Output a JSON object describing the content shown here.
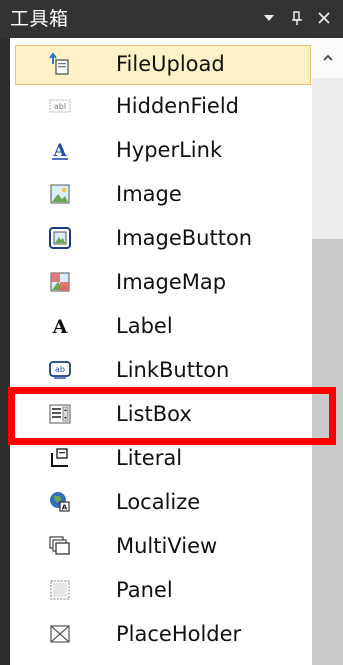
{
  "window": {
    "title": "工具箱"
  },
  "toolbar_buttons": [
    {
      "icon": "dropdown-arrow-icon"
    },
    {
      "icon": "pin-icon"
    },
    {
      "icon": "close-icon"
    }
  ],
  "items": [
    {
      "label": "FileUpload",
      "icon": "file-upload-icon",
      "selected": true
    },
    {
      "label": "HiddenField",
      "icon": "hidden-field-icon",
      "selected": false
    },
    {
      "label": "HyperLink",
      "icon": "hyperlink-icon",
      "selected": false
    },
    {
      "label": "Image",
      "icon": "image-icon",
      "selected": false
    },
    {
      "label": "ImageButton",
      "icon": "image-button-icon",
      "selected": false
    },
    {
      "label": "ImageMap",
      "icon": "image-map-icon",
      "selected": false
    },
    {
      "label": "Label",
      "icon": "label-icon",
      "selected": false
    },
    {
      "label": "LinkButton",
      "icon": "link-button-icon",
      "selected": false
    },
    {
      "label": "ListBox",
      "icon": "list-box-icon",
      "selected": false
    },
    {
      "label": "Literal",
      "icon": "literal-icon",
      "selected": false
    },
    {
      "label": "Localize",
      "icon": "localize-icon",
      "selected": false
    },
    {
      "label": "MultiView",
      "icon": "multiview-icon",
      "selected": false
    },
    {
      "label": "Panel",
      "icon": "panel-icon",
      "selected": false
    },
    {
      "label": "PlaceHolder",
      "icon": "placeholder-icon",
      "selected": false
    }
  ],
  "colors": {
    "selection_bg": "#fff1c7",
    "selection_border": "#efc16b",
    "highlight": "#ff0000",
    "window_bg": "#2d2d2d"
  }
}
